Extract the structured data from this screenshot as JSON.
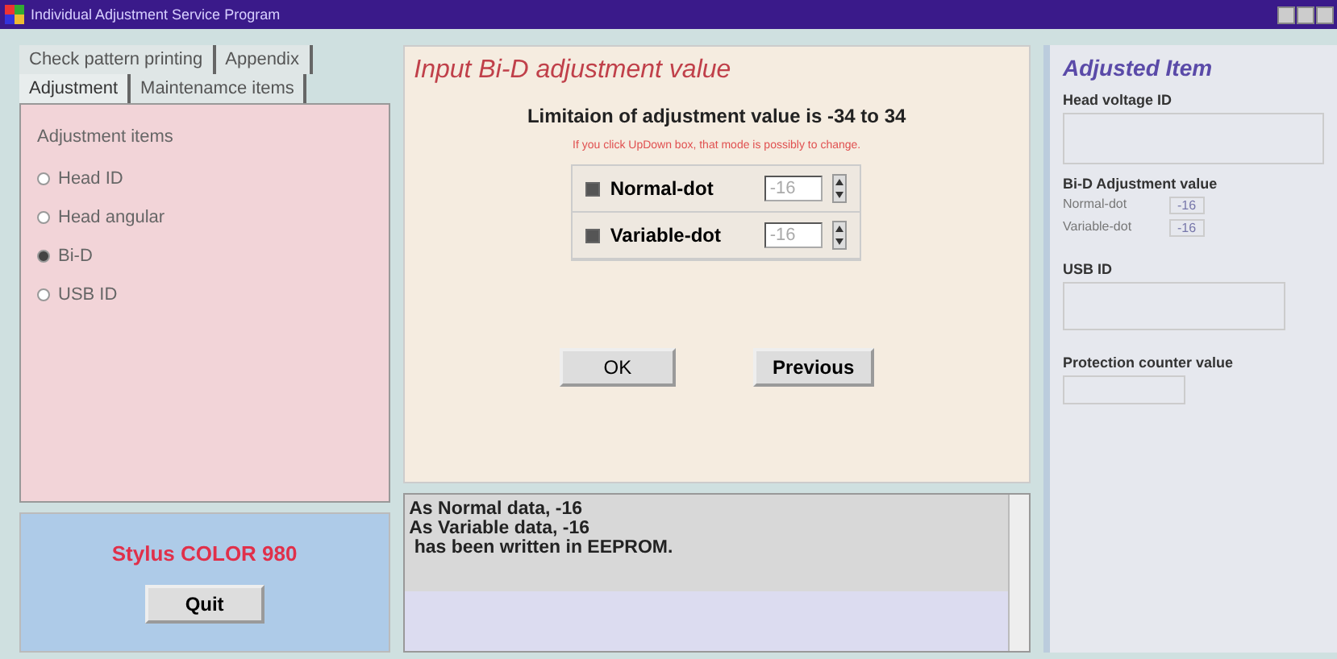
{
  "window": {
    "title": "Individual Adjustment Service Program"
  },
  "tabs": [
    [
      {
        "label": "Check pattern printing",
        "selected": false
      },
      {
        "label": "Appendix",
        "selected": false
      }
    ],
    [
      {
        "label": "Adjustment",
        "selected": true
      },
      {
        "label": "Maintenamce items",
        "selected": false
      }
    ]
  ],
  "adjustment_items": {
    "label": "Adjustment items",
    "options": [
      {
        "label": "Head ID",
        "selected": false
      },
      {
        "label": "Head angular",
        "selected": false
      },
      {
        "label": "Bi-D",
        "selected": true
      },
      {
        "label": "USB ID",
        "selected": false
      }
    ]
  },
  "model": "Stylus COLOR 980",
  "quit_button": "Quit",
  "input": {
    "title": "Input Bi-D adjustment value",
    "limit": "Limitaion of adjustment value is -34 to 34",
    "hint": "If you click UpDown box, that mode is possibly to change.",
    "rows": [
      {
        "label": "Normal-dot",
        "checked": true,
        "value": "-16"
      },
      {
        "label": "Variable-dot",
        "checked": true,
        "value": "-16"
      }
    ],
    "buttons": [
      "OK",
      "Previous"
    ]
  },
  "log": [
    "As Normal data, -16",
    "As Variable data, -16",
    " has been written in EEPROM."
  ],
  "adjusted": {
    "title": "Adjusted Item",
    "head_voltage_label": "Head voltage ID",
    "bid_label": "Bi-D Adjustment value",
    "bid_rows": [
      {
        "label": "Normal-dot",
        "value": "-16"
      },
      {
        "label": "Variable-dot",
        "value": "-16"
      }
    ],
    "usb_label": "USB ID",
    "protection_label": "Protection counter value"
  }
}
